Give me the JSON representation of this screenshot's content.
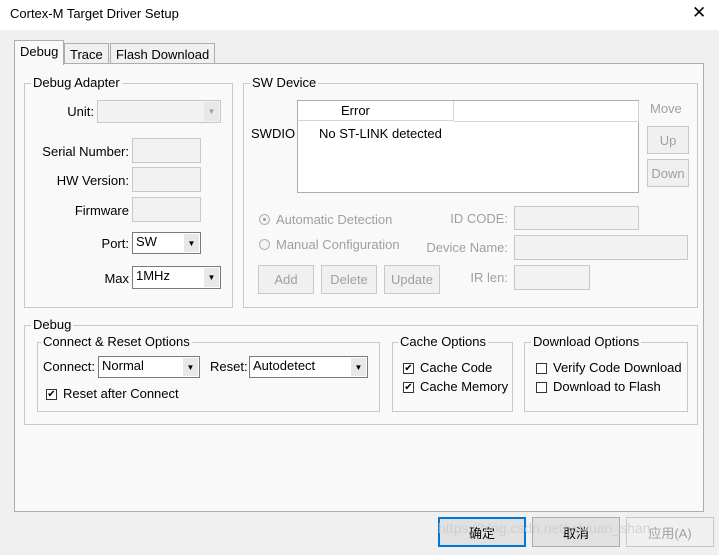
{
  "window": {
    "title": "Cortex-M Target Driver Setup",
    "close_glyph": "✕"
  },
  "tabs": [
    {
      "label": "Debug",
      "active": true
    },
    {
      "label": "Trace",
      "active": false
    },
    {
      "label": "Flash Download",
      "active": false
    }
  ],
  "debug_adapter": {
    "title": "Debug Adapter",
    "unit_label": "Unit:",
    "unit_value": "",
    "serial_label": "Serial Number:",
    "serial_value": "",
    "hw_label": "HW Version:",
    "hw_value": "",
    "firmware_label": "Firmware",
    "firmware_value": "",
    "port_label": "Port:",
    "port_value": "SW",
    "max_label": "Max",
    "max_value": "1MHz"
  },
  "sw_device": {
    "title": "SW Device",
    "row_label": "SWDIO",
    "columns": [
      "Error",
      ""
    ],
    "rows": [
      [
        "No ST-LINK detected"
      ]
    ],
    "move_label": "Move",
    "up_label": "Up",
    "down_label": "Down",
    "auto_detect_label": "Automatic Detection",
    "manual_config_label": "Manual Configuration",
    "id_code_label": "ID CODE:",
    "id_code_value": "",
    "device_name_label": "Device Name:",
    "device_name_value": "",
    "ir_len_label": "IR len:",
    "ir_len_value": "",
    "add_label": "Add",
    "delete_label": "Delete",
    "update_label": "Update"
  },
  "debug_section": {
    "title": "Debug",
    "connect_reset": {
      "title": "Connect & Reset Options",
      "connect_label": "Connect:",
      "connect_value": "Normal",
      "reset_label": "Reset:",
      "reset_value": "Autodetect",
      "reset_after_connect_label": "Reset after Connect",
      "reset_after_connect": true
    },
    "cache": {
      "title": "Cache Options",
      "cache_code_label": "Cache Code",
      "cache_code": true,
      "cache_memory_label": "Cache Memory",
      "cache_memory": true
    },
    "download": {
      "title": "Download Options",
      "verify_label": "Verify Code Download",
      "verify": false,
      "flash_label": "Download to Flash",
      "flash": false
    }
  },
  "footer": {
    "ok_label": "确定",
    "cancel_label": "取消",
    "apply_label": "应用(A)"
  },
  "watermark": "https://blog.csdn.net/ydyuan_shan",
  "icons": {
    "dropdown": "triangle-down",
    "check": "checkmark",
    "close": "x"
  },
  "colors": {
    "accent": "#0078d7",
    "disabled_text": "#a0a0a0",
    "background": "#f0f0f0"
  }
}
